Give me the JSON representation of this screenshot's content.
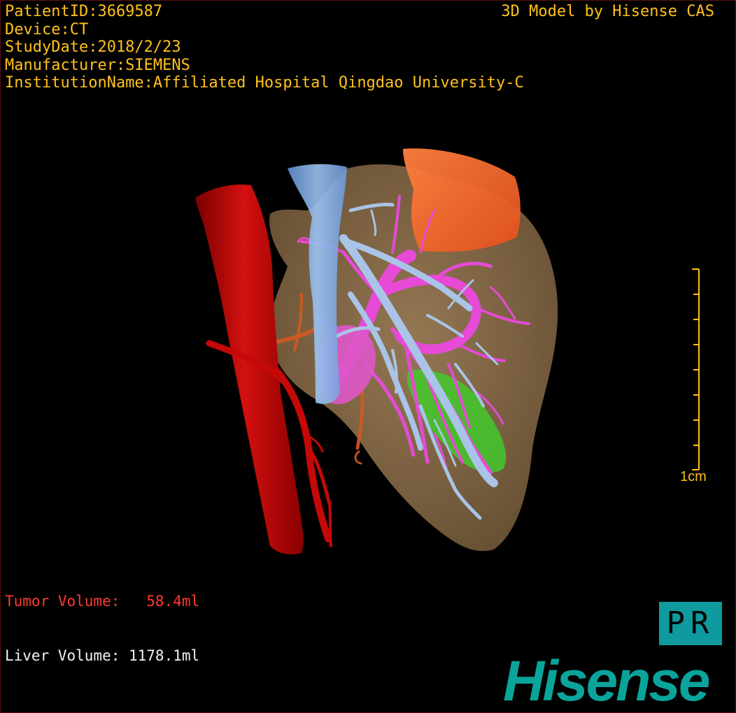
{
  "patient_info": {
    "patient_id": "PatientID:3669587",
    "device": "Device:CT",
    "study_date": "StudyDate:2018/2/23",
    "manufacturer": "Manufacturer:SIEMENS",
    "institution": "InstitutionName:Affiliated Hospital Qingdao University-C"
  },
  "header_right": "3D Model by Hisense CAS",
  "scale_bar": {
    "label": "1cm"
  },
  "volumes": {
    "tumor": "Tumor Volume:   58.4ml",
    "liver": "Liver Volume: 1178.1ml"
  },
  "view_button": {
    "label": "PR"
  },
  "logo_text": "Hisense",
  "colors": {
    "overlay_text": "#ffc21a",
    "tumor_text": "#ff3b30",
    "liver": "#8a6f4c",
    "aorta": "#c80808",
    "portal_vein": "#e64ad6",
    "hepatic_vein": "#a9c4e6",
    "ivc": "#7fb0ee",
    "gallbladder": "#ff6a2a",
    "tumor": "#3fcf2a",
    "brand": "#0aa49b"
  }
}
